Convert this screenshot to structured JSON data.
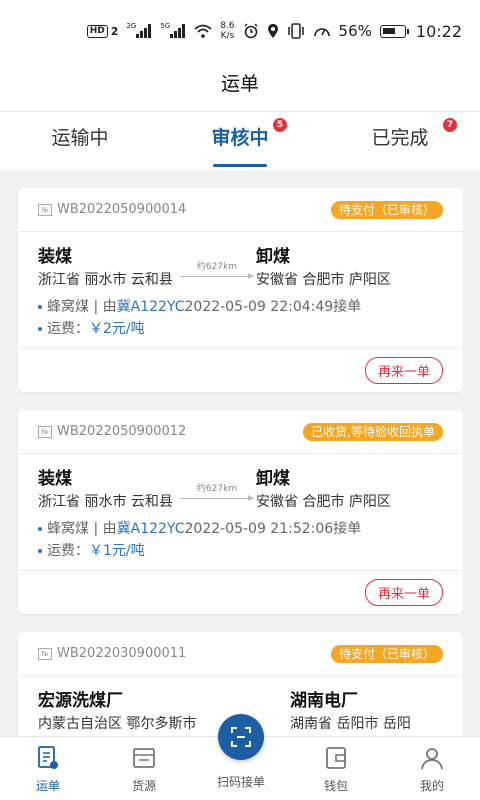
{
  "status_bar": {
    "hd_label": "HD",
    "sim": "2",
    "net1": "2G",
    "net2": "5G",
    "speed_value": "8.6",
    "speed_unit": "K/s",
    "battery": "56%",
    "time": "10:22"
  },
  "header": {
    "title": "运单"
  },
  "tabs": [
    {
      "label": "运输中",
      "badge": ""
    },
    {
      "label": "审核中",
      "badge": "5",
      "active": true
    },
    {
      "label": "已完成",
      "badge": "7"
    }
  ],
  "orders": [
    {
      "number_icon": "№",
      "number": "WB2022050900014",
      "status": "待支付（已审核）",
      "from_name": "装煤",
      "from_addr": "浙江省 丽水市 云和县",
      "distance": "约627km",
      "to_name": "卸煤",
      "to_addr": "安徽省 合肥市 庐阳区",
      "goods_prefix": "蜂窝煤 | 由",
      "plate": "冀A122YC",
      "time_text": "2022-05-09 22:04:49接单",
      "fee_label": "运费：",
      "fee": "￥2元/吨",
      "again_label": "再来一单"
    },
    {
      "number_icon": "№",
      "number": "WB2022050900012",
      "status": "已收货,等待验收回执单",
      "from_name": "装煤",
      "from_addr": "浙江省 丽水市 云和县",
      "distance": "约627km",
      "to_name": "卸煤",
      "to_addr": "安徽省 合肥市 庐阳区",
      "goods_prefix": "蜂窝煤 | 由",
      "plate": "冀A122YC",
      "time_text": "2022-05-09 21:52:06接单",
      "fee_label": "运费：",
      "fee": "￥1元/吨",
      "again_label": "再来一单"
    },
    {
      "number_icon": "№",
      "number": "WB2022030900011",
      "status": "待支付（已审核）",
      "from_name": "宏源洗煤厂",
      "from_addr": "内蒙古自治区 鄂尔多斯市",
      "to_name": "湖南电厂",
      "to_addr": "湖南省 岳阳市 岳阳"
    }
  ],
  "bottom_nav": {
    "items": [
      {
        "label": "运单",
        "icon": "waybill-icon",
        "active": true
      },
      {
        "label": "货源",
        "icon": "cargo-source-icon"
      },
      {
        "label": "扫码接单",
        "icon": "scan-icon"
      },
      {
        "label": "钱包",
        "icon": "wallet-icon"
      },
      {
        "label": "我的",
        "icon": "profile-icon"
      }
    ]
  },
  "colors": {
    "primary": "#1d5fa5",
    "badge": "#e0333a",
    "status_tag": "#f5a623",
    "link": "#2b74c4"
  }
}
